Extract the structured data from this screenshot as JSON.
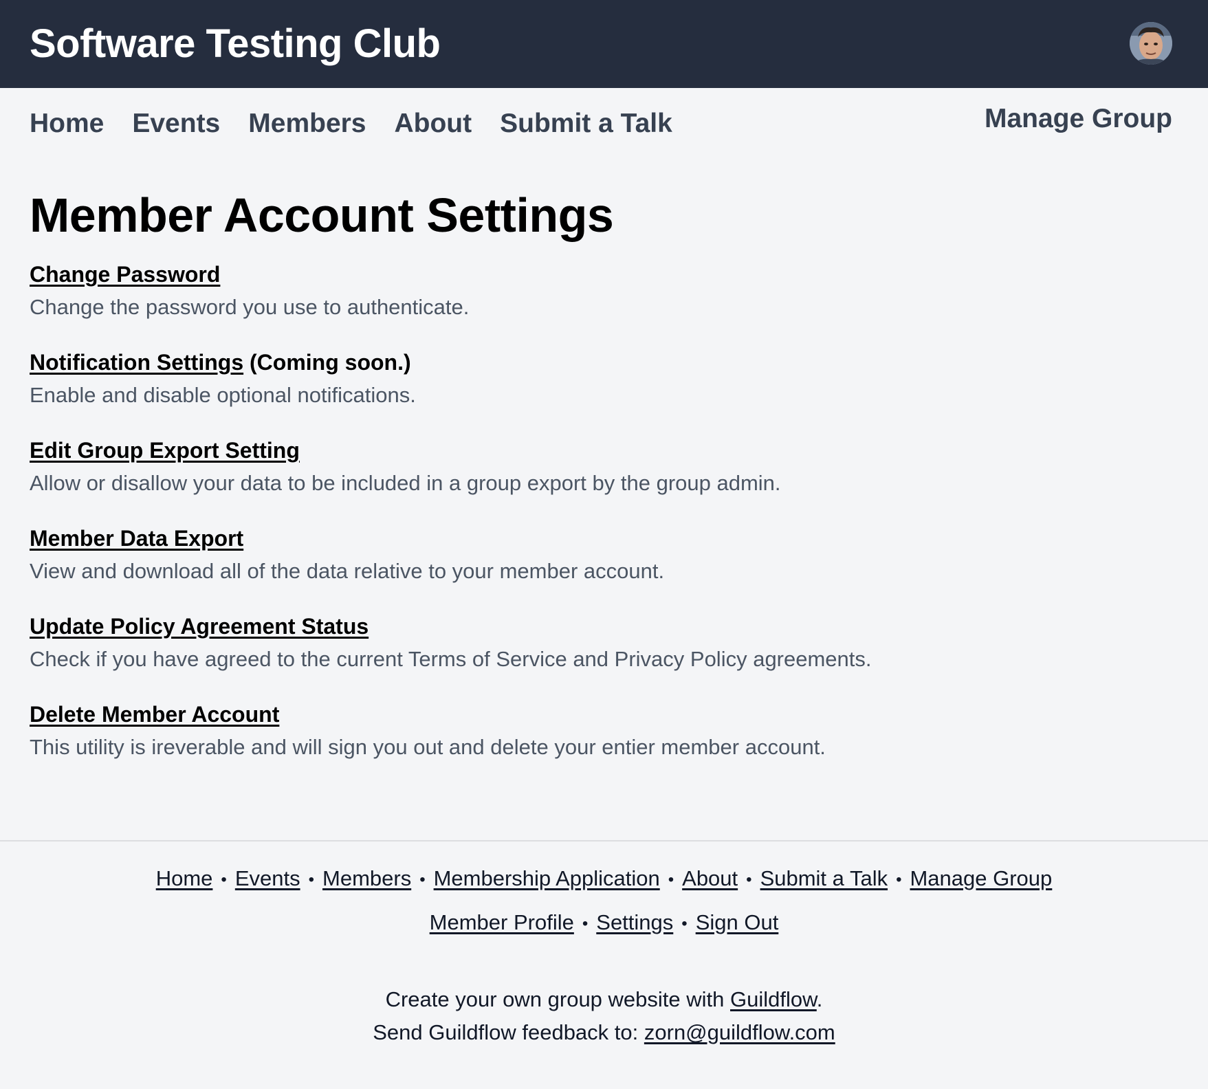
{
  "header": {
    "site_title": "Software Testing Club",
    "avatar_icon": "user-avatar-photo"
  },
  "nav": {
    "items": [
      {
        "label": "Home"
      },
      {
        "label": "Events"
      },
      {
        "label": "Members"
      },
      {
        "label": "About"
      },
      {
        "label": "Submit a Talk"
      }
    ],
    "manage_group": "Manage Group"
  },
  "main": {
    "title": "Member Account Settings",
    "settings": [
      {
        "link": "Change Password",
        "suffix": "",
        "description": "Change the password you use to authenticate."
      },
      {
        "link": "Notification Settings",
        "suffix": " (Coming soon.)",
        "description": "Enable and disable optional notifications."
      },
      {
        "link": "Edit Group Export Setting",
        "suffix": "",
        "description": "Allow or disallow your data to be included in a group export by the group admin."
      },
      {
        "link": "Member Data Export",
        "suffix": "",
        "description": "View and download all of the data relative to your member account."
      },
      {
        "link": "Update Policy Agreement Status",
        "suffix": "",
        "description": "Check if you have agreed to the current Terms of Service and Privacy Policy agreements."
      },
      {
        "link": "Delete Member Account",
        "suffix": "",
        "description": "This utility is ireverable and will sign you out and delete your entier member account."
      }
    ]
  },
  "footer": {
    "row1": [
      "Home",
      "Events",
      "Members",
      "Membership Application",
      "About",
      "Submit a Talk",
      "Manage Group"
    ],
    "row2": [
      "Member Profile",
      "Settings",
      "Sign Out"
    ],
    "separator": "•",
    "promo_prefix": "Create your own group website with ",
    "promo_link": "Guildflow",
    "promo_suffix": ".",
    "feedback_prefix": "Send Guildflow feedback to: ",
    "feedback_email": "zorn@guildflow.com"
  },
  "colors": {
    "header_bg": "#252d3e",
    "page_bg": "#f4f5f7",
    "nav_text": "#374151",
    "description_text": "#4b5563"
  }
}
